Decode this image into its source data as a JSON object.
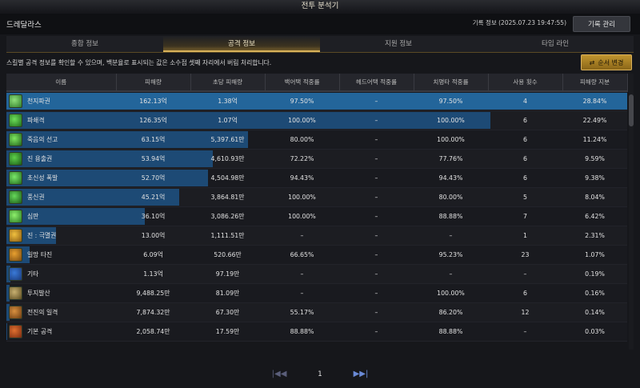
{
  "window": {
    "title": "전투 분석기"
  },
  "header": {
    "character_name": "드레달라스",
    "record_info": "기록 정보 (2025.07.23 19:47:55)",
    "record_manage_label": "기록 관리"
  },
  "tabs": [
    {
      "label": "종합 정보",
      "active": false
    },
    {
      "label": "공격 정보",
      "active": true
    },
    {
      "label": "지원 정보",
      "active": false
    },
    {
      "label": "타임 라인",
      "active": false
    }
  ],
  "description": "스킬별 공격 정보를 확인할 수 있으며, 백분율로 표시되는 값은 소수점 셋째 자리에서 버림 처리합니다.",
  "order_button_label": "순서 변경",
  "table": {
    "headers": [
      "이름",
      "피해량",
      "초당 피해량",
      "백어택 적중률",
      "헤드어택 적중률",
      "치명타 적중률",
      "사용 횟수",
      "피해량 지분"
    ],
    "rows": [
      {
        "icon": "skill-icon-1",
        "name": "천지파권",
        "damage": "162.13억",
        "dps": "1.38억",
        "back": "97.50%",
        "head": "–",
        "crit": "97.50%",
        "uses": "4",
        "share": "28.84%",
        "share_value": 28.84
      },
      {
        "icon": "skill-icon-2",
        "name": "파쇄격",
        "damage": "126.35억",
        "dps": "1.07억",
        "back": "100.00%",
        "head": "–",
        "crit": "100.00%",
        "uses": "6",
        "share": "22.49%",
        "share_value": 22.49
      },
      {
        "icon": "skill-icon-3",
        "name": "죽음의 선고",
        "damage": "63.15억",
        "dps": "5,397.61만",
        "back": "80.00%",
        "head": "–",
        "crit": "100.00%",
        "uses": "6",
        "share": "11.24%",
        "share_value": 11.24
      },
      {
        "icon": "skill-icon-4",
        "name": "진 용출권",
        "damage": "53.94억",
        "dps": "4,610.93만",
        "back": "72.22%",
        "head": "–",
        "crit": "77.76%",
        "uses": "6",
        "share": "9.59%",
        "share_value": 9.59
      },
      {
        "icon": "skill-icon-5",
        "name": "초신성 폭발",
        "damage": "52.70억",
        "dps": "4,504.98만",
        "back": "94.43%",
        "head": "–",
        "crit": "94.43%",
        "uses": "6",
        "share": "9.38%",
        "share_value": 9.38
      },
      {
        "icon": "skill-icon-6",
        "name": "풍신권",
        "damage": "45.21억",
        "dps": "3,864.81만",
        "back": "100.00%",
        "head": "–",
        "crit": "80.00%",
        "uses": "5",
        "share": "8.04%",
        "share_value": 8.04
      },
      {
        "icon": "skill-icon-7",
        "name": "심판",
        "damage": "36.10억",
        "dps": "3,086.26만",
        "back": "100.00%",
        "head": "–",
        "crit": "88.88%",
        "uses": "7",
        "share": "6.42%",
        "share_value": 6.42
      },
      {
        "icon": "skill-icon-8",
        "name": "진 : 극멸권",
        "damage": "13.00억",
        "dps": "1,111.51만",
        "back": "–",
        "head": "–",
        "crit": "–",
        "uses": "1",
        "share": "2.31%",
        "share_value": 2.31
      },
      {
        "icon": "skill-icon-9",
        "name": "일망 타진",
        "damage": "6.09억",
        "dps": "520.66만",
        "back": "66.65%",
        "head": "–",
        "crit": "95.23%",
        "uses": "23",
        "share": "1.07%",
        "share_value": 1.07
      },
      {
        "icon": "skill-icon-10",
        "name": "기타",
        "damage": "1.13억",
        "dps": "97.19만",
        "back": "–",
        "head": "–",
        "crit": "–",
        "uses": "–",
        "share": "0.19%",
        "share_value": 0.19
      },
      {
        "icon": "skill-icon-11",
        "name": "투지발산",
        "damage": "9,488.25만",
        "dps": "81.09만",
        "back": "–",
        "head": "–",
        "crit": "100.00%",
        "uses": "6",
        "share": "0.16%",
        "share_value": 0.16
      },
      {
        "icon": "skill-icon-12",
        "name": "전진의 일격",
        "damage": "7,874.32만",
        "dps": "67.30만",
        "back": "55.17%",
        "head": "–",
        "crit": "86.20%",
        "uses": "12",
        "share": "0.14%",
        "share_value": 0.14
      },
      {
        "icon": "skill-icon-13",
        "name": "기본 공격",
        "damage": "2,058.74만",
        "dps": "17.59만",
        "back": "88.88%",
        "head": "–",
        "crit": "88.88%",
        "uses": "–",
        "share": "0.03%",
        "share_value": 0.03
      }
    ]
  },
  "pagination": {
    "current_page": "1"
  },
  "colors": {
    "accent_gold": "#d8b25a",
    "bar_blue": "#1d4a75",
    "bar_selected": "#23659a"
  }
}
